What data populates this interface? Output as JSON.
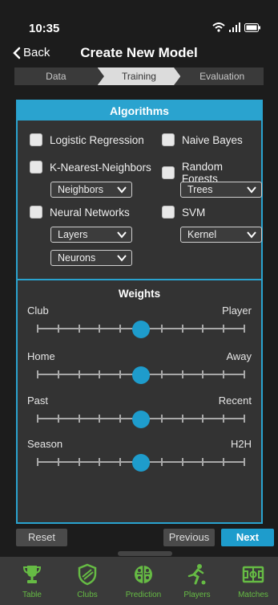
{
  "status": {
    "time": "10:35"
  },
  "header": {
    "back_label": "Back",
    "title": "Create New Model"
  },
  "steps": [
    {
      "label": "Data"
    },
    {
      "label": "Training"
    },
    {
      "label": "Evaluation"
    }
  ],
  "algorithms": {
    "title": "Algorithms",
    "items": [
      {
        "label": "Logistic Regression",
        "checked": false
      },
      {
        "label": "Naive Bayes",
        "checked": false
      },
      {
        "label": "K-Nearest-Neighbors",
        "checked": false
      },
      {
        "label": "Random Forests",
        "checked": false
      },
      {
        "label": "Neural Networks",
        "checked": false
      },
      {
        "label": "SVM",
        "checked": false
      }
    ],
    "dropdowns": {
      "neighbors": "Neighbors",
      "trees": "Trees",
      "layers": "Layers",
      "kernel": "Kernel",
      "neurons": "Neurons"
    }
  },
  "weights": {
    "title": "Weights",
    "sliders": [
      {
        "left": "Club",
        "right": "Player",
        "value": 0.5
      },
      {
        "left": "Home",
        "right": "Away",
        "value": 0.5
      },
      {
        "left": "Past",
        "right": "Recent",
        "value": 0.5
      },
      {
        "left": "Season",
        "right": "H2H",
        "value": 0.5
      }
    ]
  },
  "buttons": {
    "reset": "Reset",
    "previous": "Previous",
    "next": "Next"
  },
  "tabs": [
    {
      "label": "Table",
      "icon": "trophy-icon"
    },
    {
      "label": "Clubs",
      "icon": "shield-icon"
    },
    {
      "label": "Prediction",
      "icon": "brain-icon"
    },
    {
      "label": "Players",
      "icon": "player-kick-icon"
    },
    {
      "label": "Matches",
      "icon": "pitch-icon"
    }
  ],
  "colors": {
    "accent": "#2aa3cf",
    "tab_green": "#66bb44",
    "background": "#1c1c1c",
    "panel": "#333333"
  }
}
